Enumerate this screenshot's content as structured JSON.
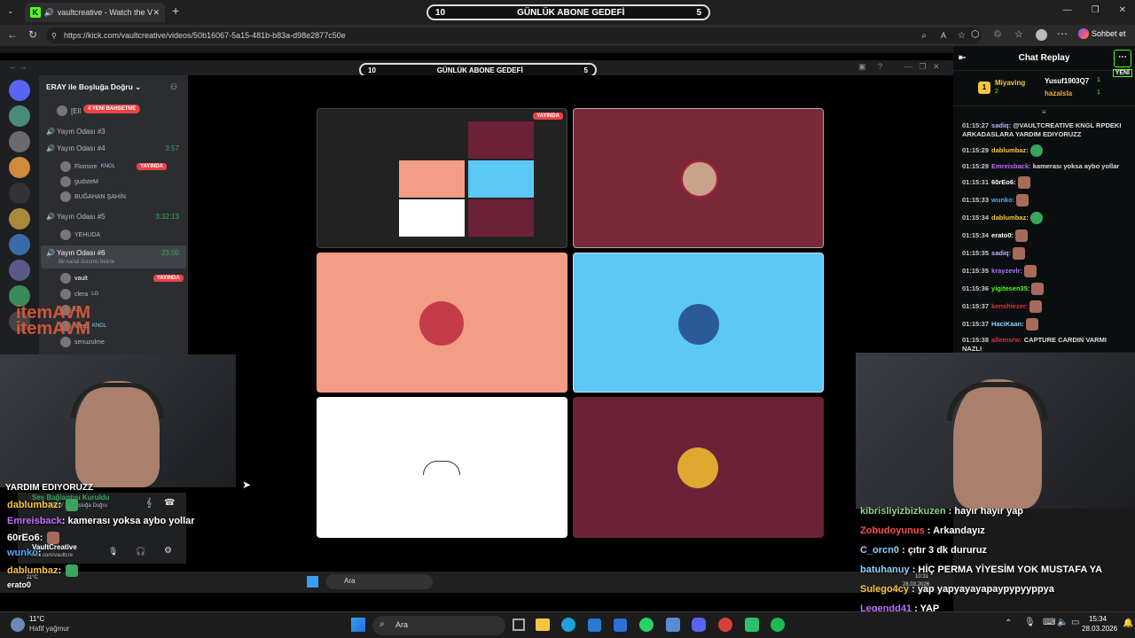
{
  "browser": {
    "tab_title": "vaultcreative - Watch the VOD",
    "favicon": "K",
    "url": "https://kick.com/vaultcreative/videos/50b16067-5a15-481b-b83a-d98e2877c50e",
    "copilot_label": "Sohbet et"
  },
  "goal": {
    "left": "10",
    "label": "GÜNLÜK ABONE GEDEFİ",
    "right": "5"
  },
  "goal_inner": {
    "left": "10",
    "label": "GÜNLÜK ABONE GEDEFİ",
    "right": "5"
  },
  "discord": {
    "server_name": "ERAY ile Boşluğa Doğru",
    "new_event_badge": "4 YENİ BAHSETME",
    "truncated_user": "[Ell",
    "channels": [
      {
        "name": "Yayın Odası #3",
        "time": ""
      },
      {
        "name": "Yayın Odası #4",
        "time": "3:57"
      },
      {
        "name": "Yayın Odası #5",
        "time": "3:32:13"
      },
      {
        "name": "Yayın Odası #6",
        "time": "23:00"
      }
    ],
    "room4_users": [
      "Flomore",
      "gudsteM",
      "BUĞAHAN ŞAHİN"
    ],
    "room4_kngl": "KNGL",
    "room5_users": [
      "YEHUDA"
    ],
    "room6_status": "Bir kanal durumu belirle",
    "room6_users": [
      "vault",
      "clera",
      "Merd",
      "senuzulme"
    ],
    "tag_lg": "LG",
    "live_label": "YAYINDA",
    "watermark": "itemAVM",
    "connection": "Ses Bağlantısı Kuruldu",
    "connection_sub": "ERAY ile Boşluğa Doğru",
    "user_name": "VaultCreative",
    "user_sub": "kick.com/vaultcre"
  },
  "chat_replay": {
    "title": "Chat Replay",
    "top_gifters": [
      {
        "rank": "1",
        "name": "Miyaving",
        "count": "2"
      },
      {
        "rank": "",
        "name": "Yusuf1903Q7",
        "count": "1"
      },
      {
        "rank": "",
        "name": "hazalsla",
        "count": "1"
      }
    ],
    "new_label": "YENİ",
    "messages": [
      {
        "time": "01:15:27",
        "user": "sadiq:",
        "color": "#b4b4ff",
        "text": "@VAULTCREATIVE KNGL RPDEKI ARKADASLARA YARDIM EDIYORUZZ"
      },
      {
        "time": "01:15:29",
        "user": "dablumbaz:",
        "color": "#f5c542",
        "text": ""
      },
      {
        "time": "01:15:29",
        "user": "Emreisback:",
        "color": "#c36bff",
        "text": "kamerası yoksa aybo yollar"
      },
      {
        "time": "01:15:31",
        "user": "60rEo6:",
        "color": "#ffffff",
        "text": ""
      },
      {
        "time": "01:15:33",
        "user": "wunko:",
        "color": "#4aa8ff",
        "text": ""
      },
      {
        "time": "01:15:34",
        "user": "dablumbaz:",
        "color": "#f5c542",
        "text": ""
      },
      {
        "time": "01:15:34",
        "user": "erato0:",
        "color": "#ffffff",
        "text": ""
      },
      {
        "time": "01:15:35",
        "user": "sadiq:",
        "color": "#b4b4ff",
        "text": ""
      },
      {
        "time": "01:15:35",
        "user": "krayzevlr:",
        "color": "#a875ff",
        "text": ""
      },
      {
        "time": "01:15:36",
        "user": "yigitesen35:",
        "color": "#53fc18",
        "text": ""
      },
      {
        "time": "01:15:37",
        "user": "kenshiezer:",
        "color": "#e0303d",
        "text": ""
      },
      {
        "time": "01:15:37",
        "user": "HaciKaan:",
        "color": "#8fd3ff",
        "text": ""
      },
      {
        "time": "01:15:38",
        "user": "allemsrw:",
        "color": "#e0303d",
        "text": "CAPTURE CARDIN VARMI NAZLI"
      }
    ]
  },
  "overlay_left": [
    {
      "user": "YARDIM EDIYORUZZ",
      "color": "#ffffff",
      "text": ""
    },
    {
      "user": "dablumbaz",
      "color": "#f5c542",
      "text": ":"
    },
    {
      "user": "Emreisback",
      "color": "#c36bff",
      "text": ": kamerası yoksa aybo yollar"
    },
    {
      "user": "60rEo6",
      "color": "#ffffff",
      "text": ":"
    },
    {
      "user": "wunko",
      "color": "#4aa8ff",
      "text": ":"
    },
    {
      "user": "dablumbaz",
      "color": "#f5c542",
      "text": ":"
    },
    {
      "user": "erato0",
      "color": "#ffffff",
      "text": ":"
    }
  ],
  "overlay_right": [
    {
      "user": "kibrisliyizbizkuzen",
      "color": "#8fd38f",
      "text": ": hayır hayır yap"
    },
    {
      "user": "Zobudoyunus",
      "color": "#ff4d4d",
      "text": ": Arkandayız"
    },
    {
      "user": "C_orcn0",
      "color": "#8fd3ff",
      "text": ": çıtır 3 dk dururuz"
    },
    {
      "user": "batuhanuy",
      "color": "#8fd3ff",
      "text": ": HİÇ PERMA YİYESİM YOK MUSTAFA YA"
    },
    {
      "user": "Sulego4cy",
      "color": "#f5c542",
      "text": ": yap yapyayayapaypypyyppya"
    },
    {
      "user": "Legendd41",
      "color": "#c36bff",
      "text": ": YAP"
    }
  ],
  "taskbar": {
    "weather_temp": "11°C",
    "weather_desc": "Hafif yağmur",
    "search": "Ara",
    "time": "15:34",
    "date": "28.03.2026"
  },
  "inner_taskbar": {
    "temp": "11°C",
    "search": "Ara",
    "time": "10:31",
    "date": "28.03.2026"
  }
}
